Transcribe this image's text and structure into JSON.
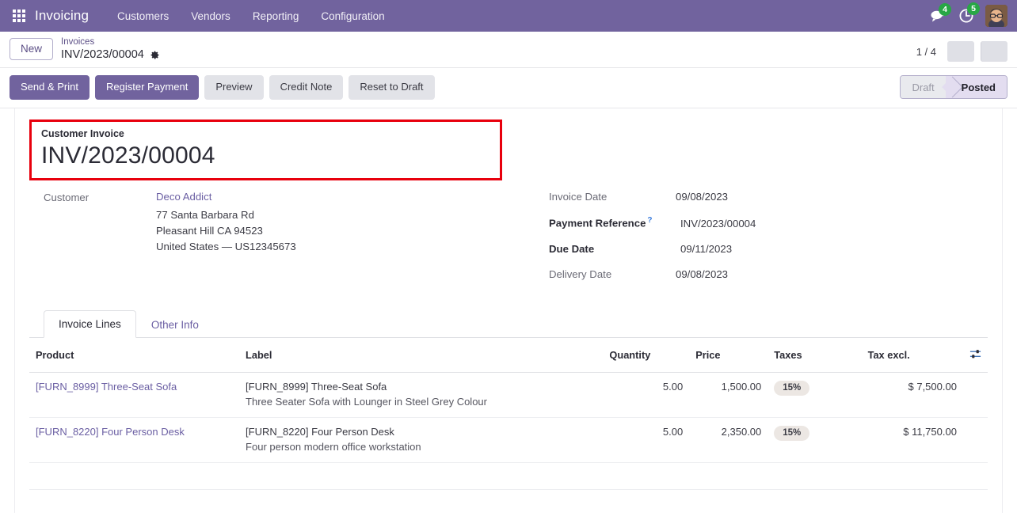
{
  "navbar": {
    "apps_icon": "apps-grid-icon",
    "brand": "Invoicing",
    "menu": [
      {
        "label": "Customers"
      },
      {
        "label": "Vendors"
      },
      {
        "label": "Reporting"
      },
      {
        "label": "Configuration"
      }
    ],
    "messages_icon": "messages-icon",
    "messages_count": "4",
    "activities_icon": "activity-clock-icon",
    "activities_count": "5",
    "avatar": "user-avatar"
  },
  "control_panel": {
    "new_label": "New",
    "breadcrumb_parent": "Invoices",
    "breadcrumb_current": "INV/2023/00004",
    "gear_icon": "gear-icon",
    "pager": "1 / 4",
    "pager_prev_icon": "chevron-left-icon",
    "pager_next_icon": "chevron-right-icon"
  },
  "actions": {
    "buttons": [
      {
        "label": "Send & Print",
        "style": "primary"
      },
      {
        "label": "Register Payment",
        "style": "primary"
      },
      {
        "label": "Preview",
        "style": "secondary"
      },
      {
        "label": "Credit Note",
        "style": "secondary"
      },
      {
        "label": "Reset to Draft",
        "style": "secondary"
      }
    ],
    "status_steps": [
      {
        "label": "Draft",
        "active": false
      },
      {
        "label": "Posted",
        "active": true
      }
    ]
  },
  "form": {
    "title_label": "Customer Invoice",
    "title_value": "INV/2023/00004",
    "highlight_color": "#e8000d",
    "customer_label": "Customer",
    "customer_name": "Deco Addict",
    "customer_address": [
      "77 Santa Barbara Rd",
      "Pleasant Hill CA 94523",
      "United States — US12345673"
    ],
    "invoice_date_label": "Invoice Date",
    "invoice_date_value": "09/08/2023",
    "payment_reference_label": "Payment Reference",
    "payment_reference_help": "?",
    "payment_reference_value": "INV/2023/00004",
    "due_date_label": "Due Date",
    "due_date_value": "09/11/2023",
    "delivery_date_label": "Delivery Date",
    "delivery_date_value": "09/08/2023"
  },
  "tabs": [
    {
      "label": "Invoice Lines",
      "active": true
    },
    {
      "label": "Other Info",
      "active": false
    }
  ],
  "lines_table": {
    "columns": {
      "product": "Product",
      "label": "Label",
      "quantity": "Quantity",
      "price": "Price",
      "taxes": "Taxes",
      "total": "Tax excl."
    },
    "optional_columns_icon": "sliders-toggle-icon",
    "rows": [
      {
        "product": "[FURN_8999] Three-Seat Sofa",
        "label": "[FURN_8999] Three-Seat Sofa",
        "description": "Three Seater Sofa with Lounger in Steel Grey Colour",
        "quantity": "5.00",
        "price": "1,500.00",
        "tax": "15%",
        "total": "$ 7,500.00"
      },
      {
        "product": "[FURN_8220] Four Person Desk",
        "label": "[FURN_8220] Four Person Desk",
        "description": "Four person modern office workstation",
        "quantity": "5.00",
        "price": "2,350.00",
        "tax": "15%",
        "total": "$ 11,750.00"
      }
    ]
  }
}
